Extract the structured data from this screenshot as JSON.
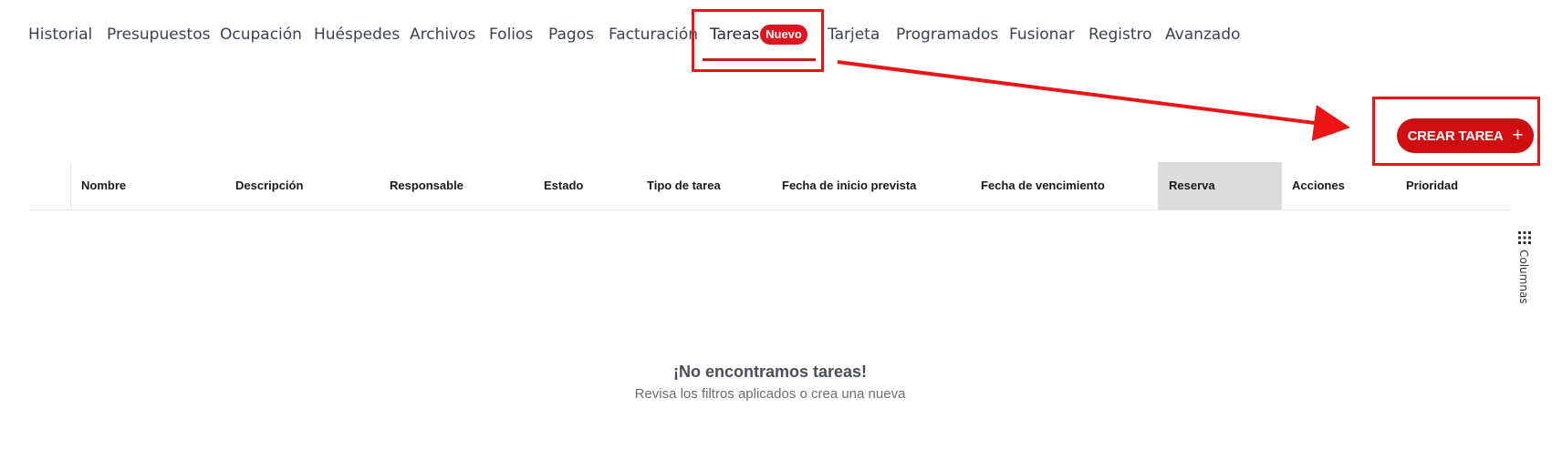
{
  "tabs": {
    "items": [
      {
        "label": "Historial"
      },
      {
        "label": "Presupuestos"
      },
      {
        "label": "Ocupación"
      },
      {
        "label": "Huéspedes"
      },
      {
        "label": "Archivos"
      },
      {
        "label": "Folios"
      },
      {
        "label": "Pagos"
      },
      {
        "label": "Facturación"
      },
      {
        "label": "Tareas",
        "badge": "Nuevo"
      },
      {
        "label": "Tarjeta"
      },
      {
        "label": "Programados"
      },
      {
        "label": "Fusionar"
      },
      {
        "label": "Registro"
      },
      {
        "label": "Avanzado"
      }
    ],
    "active": "Tareas"
  },
  "actions": {
    "create_label": "CREAR TAREA",
    "create_icon": "plus-icon"
  },
  "table": {
    "columns": [
      "Nombre",
      "Descripción",
      "Responsable",
      "Estado",
      "Tipo de tarea",
      "Fecha de inicio prevista",
      "Fecha de vencimiento",
      "Reserva",
      "Acciones",
      "Prioridad"
    ],
    "highlighted_column": "Reserva"
  },
  "columns_toggle": {
    "label": "Columnas",
    "icon": "grid-dots-icon"
  },
  "empty_state": {
    "title": "¡No encontramos tareas!",
    "subtitle": "Revisa los filtros aplicados o crea una nueva"
  },
  "colors": {
    "accent": "#cf0f0f",
    "badge": "#e0141e",
    "annotation": "#ec1515",
    "highlight_column_bg": "#dcdcdc"
  }
}
